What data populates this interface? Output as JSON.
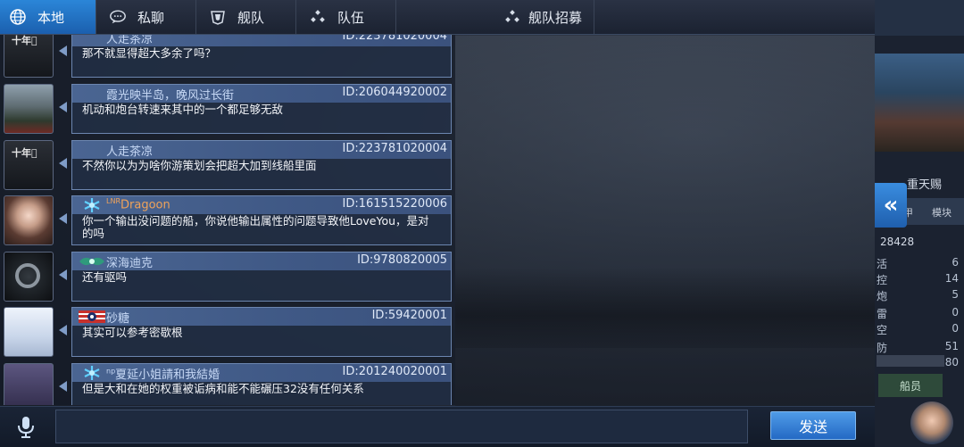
{
  "tabs": [
    {
      "label": "本地",
      "icon": "globe-icon",
      "active": true
    },
    {
      "label": "私聊",
      "icon": "chat-bubble-icon",
      "active": false
    },
    {
      "label": "舰队",
      "icon": "fleet-emblem-icon",
      "active": false
    },
    {
      "label": "队伍",
      "icon": "team-dots-icon",
      "active": false
    },
    {
      "label": "舰队招募",
      "icon": "recruit-dots-icon",
      "active": false
    }
  ],
  "messages": [
    {
      "name": "人走茶凉",
      "id": "ID:223781020004",
      "text": "那不就显得超大多余了吗？",
      "avatar": "dark-2000-avatar",
      "badge": ""
    },
    {
      "name": "霞光映半岛，晚风过长街",
      "id": "ID:206044920002",
      "text": "机动和炮台转速来其中的一个都足够无敌",
      "avatar": "mountain-avatar",
      "badge": ""
    },
    {
      "name": "人走茶凉",
      "id": "ID:223781020004",
      "text": "不然你以为为啥你游策划会把超大加到线船里面",
      "avatar": "dark-2000-avatar",
      "badge": ""
    },
    {
      "name": "Dragoon",
      "name_prefix": "LNR",
      "id": "ID:161515220006",
      "text": "你一个输出没问题的船，你说他输出属性的问题导致他LoveYou，是对的吗",
      "avatar": "girl-avatar",
      "badge": "snowflake"
    },
    {
      "name": "深海迪克",
      "id": "ID:9780820005",
      "text": "还有驱吗",
      "avatar": "wheel-avatar",
      "badge": "green-wings"
    },
    {
      "name": "砂糖",
      "id": "ID:59420001",
      "text": "其实可以参考密歇根",
      "avatar": "white-hair-avatar",
      "badge": "flag"
    },
    {
      "name": "夏延小姐請和我結婚",
      "name_prefix": "np",
      "id": "ID:201240020001",
      "text": "但是大和在她的权重被诟病和能不能碾压32没有任何关系",
      "avatar": "purple-avatar",
      "badge": "snowflake"
    }
  ],
  "input": {
    "value": "",
    "placeholder": ""
  },
  "send_label": "发送",
  "side": {
    "title": "重天赐",
    "btn1": "甲",
    "btn2": "模块",
    "power": "28428",
    "stats": [
      {
        "label": "活",
        "value": "6"
      },
      {
        "label": "控",
        "value": "14"
      },
      {
        "label": "炮",
        "value": "5"
      },
      {
        "label": "雷",
        "value": "0"
      },
      {
        "label": "空",
        "value": "0"
      },
      {
        "label": "防",
        "value": "51"
      },
      {
        "label": "",
        "value": "80"
      }
    ],
    "crew": "船员",
    "collapse_icon": "double-chevron-left-icon"
  },
  "colors": {
    "accent": "#2b86d8",
    "send": "#3e86d8",
    "name_blue": "#c6d8f5",
    "name_orange": "#f0a35a"
  }
}
